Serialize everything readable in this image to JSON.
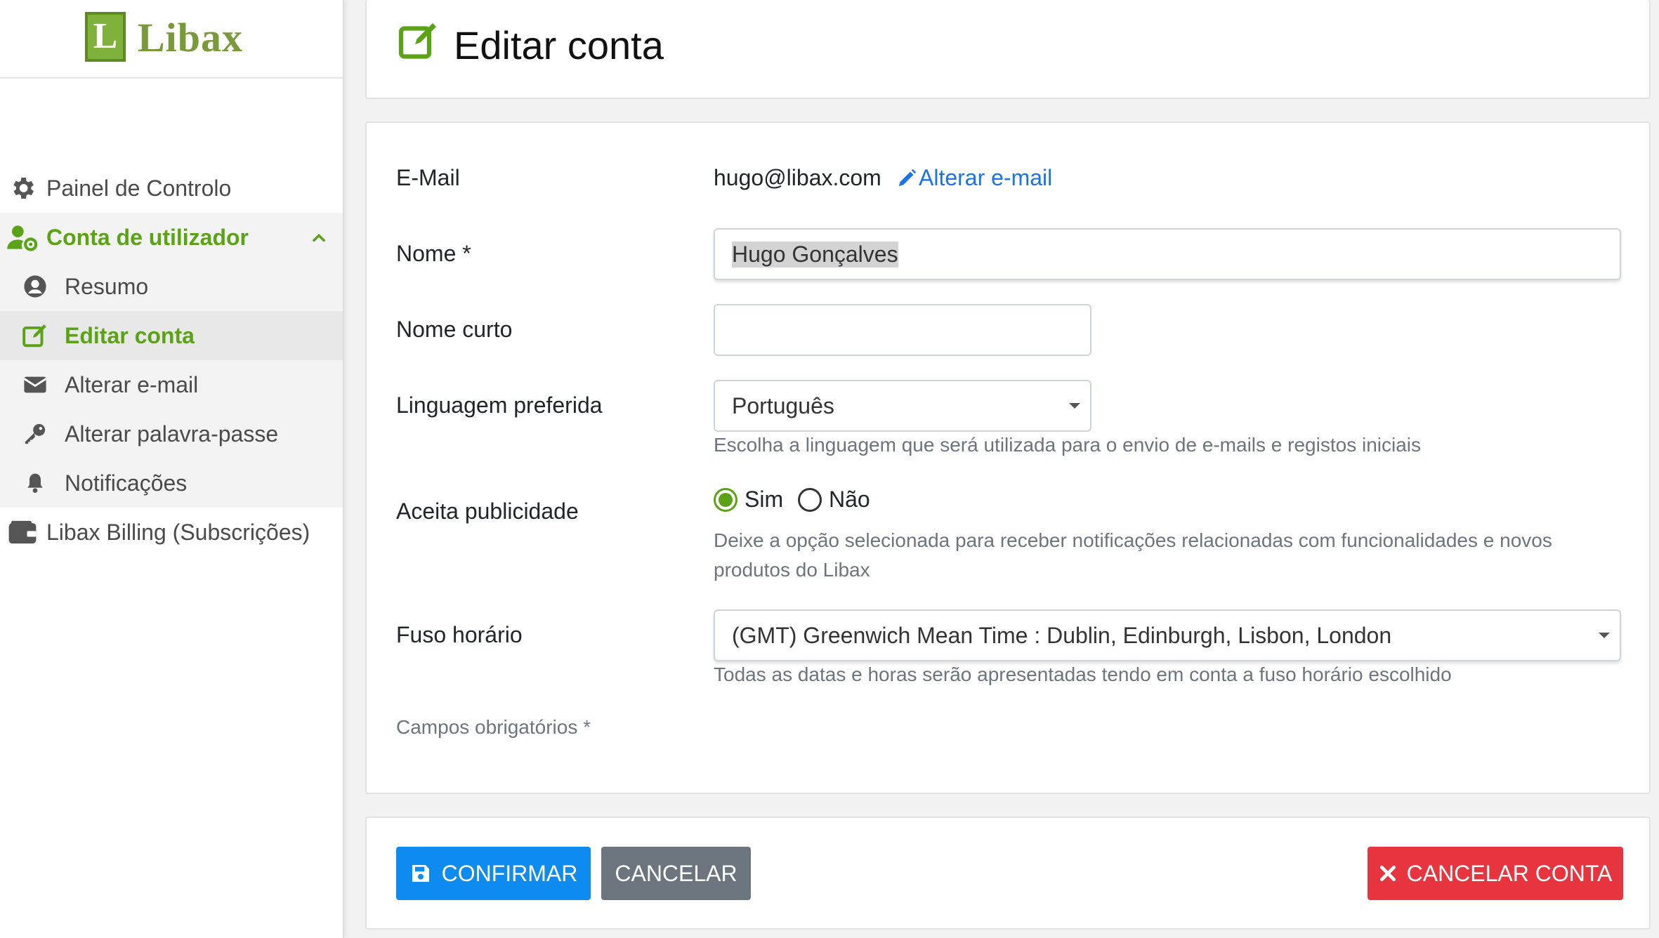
{
  "brand": {
    "logo_letter": "L",
    "name": "Libax"
  },
  "sidebar": {
    "items": [
      {
        "label": "Painel de Controlo",
        "icon": "gear-icon"
      },
      {
        "label": "Conta de utilizador",
        "icon": "user-gear-icon"
      },
      {
        "label": "Resumo",
        "icon": "user-circle-icon"
      },
      {
        "label": "Editar conta",
        "icon": "edit-icon"
      },
      {
        "label": "Alterar e-mail",
        "icon": "envelope-icon"
      },
      {
        "label": "Alterar palavra-passe",
        "icon": "key-icon"
      },
      {
        "label": "Notificações",
        "icon": "bell-icon"
      },
      {
        "label": "Libax Billing (Subscrições)",
        "icon": "wallet-icon"
      }
    ]
  },
  "header": {
    "title": "Editar conta"
  },
  "form": {
    "email_label": "E-Mail",
    "email_value": "hugo@libax.com",
    "change_email_link": "Alterar e-mail",
    "name_label": "Nome *",
    "name_value": "Hugo Gonçalves",
    "shortname_label": "Nome curto",
    "shortname_value": "",
    "language_label": "Linguagem preferida",
    "language_value": "Português",
    "language_help": "Escolha a linguagem que será utilizada para o envio de e-mails e registos iniciais",
    "ads_label": "Aceita publicidade",
    "ads_yes": "Sim",
    "ads_no": "Não",
    "ads_selected": "Sim",
    "ads_help_1": "Deixe a opção selecionada para receber notificações relacionadas com funcionalidades e novos",
    "ads_help_2": "produtos do Libax",
    "timezone_label": "Fuso horário",
    "timezone_value": "(GMT) Greenwich Mean Time : Dublin, Edinburgh, Lisbon, London",
    "timezone_help": "Todas as datas e horas serão apresentadas tendo em conta a fuso horário escolhido",
    "required_note": "Campos obrigatórios *"
  },
  "actions": {
    "confirm": "CONFIRMAR",
    "cancel": "CANCELAR",
    "cancel_account": "CANCELAR CONTA"
  },
  "colors": {
    "accent_green": "#5aa316",
    "primary_blue": "#0d8bf0",
    "danger_red": "#e8343f",
    "secondary_gray": "#6c757d",
    "link_blue": "#1a73e8"
  }
}
